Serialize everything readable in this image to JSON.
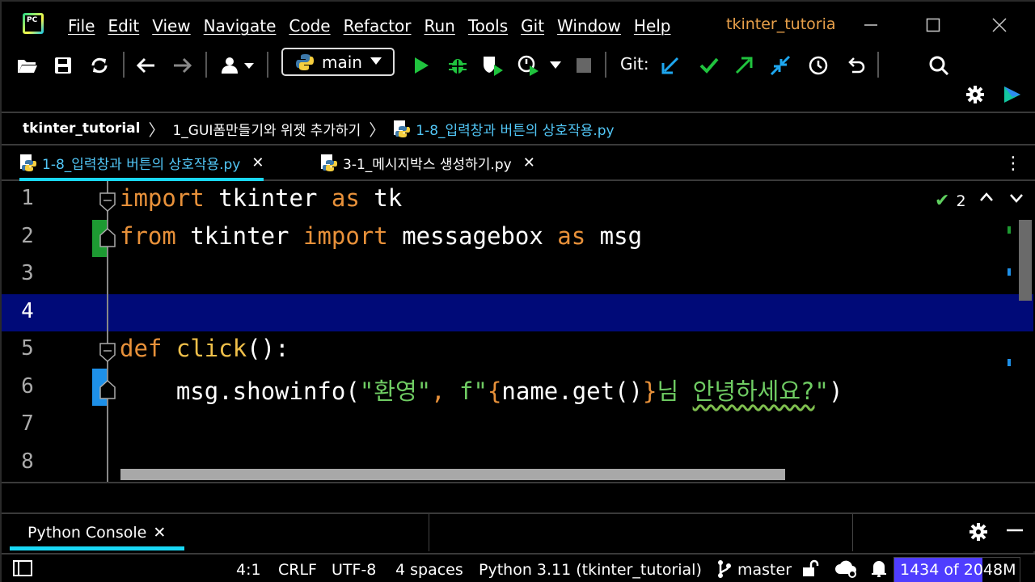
{
  "menubar": {
    "items": [
      "File",
      "Edit",
      "View",
      "Navigate",
      "Code",
      "Refactor",
      "Run",
      "Tools",
      "Git",
      "Window",
      "Help"
    ],
    "project_title": "tkinter_tutoria",
    "logo_text": "PC"
  },
  "toolbar": {
    "branch": "main",
    "git_label": "Git:",
    "icons": [
      "open-folder-icon",
      "save-icon",
      "sync-icon",
      "back-icon",
      "forward-icon",
      "user-icon",
      "run-icon",
      "debug-icon",
      "coverage-icon",
      "profile-icon",
      "stop-icon",
      "git-update-icon",
      "git-commit-icon",
      "git-push-icon",
      "git-merge-icon",
      "history-icon",
      "rollback-icon",
      "search-icon",
      "settings-icon",
      "jetbrains-ai-icon"
    ]
  },
  "breadcrumb": {
    "project": "tkinter_tutorial",
    "folder": "1_GUI폼만들기와 위젯 추가하기",
    "file": "1-8_입력창과 버튼의 상호작용.py"
  },
  "tabs": [
    {
      "label": "1-8_입력창과 버튼의 상호작용.py",
      "active": true
    },
    {
      "label": "3-1_메시지박스 생성하기.py",
      "active": false
    }
  ],
  "editor": {
    "inspection_count": "2",
    "current_line": 4,
    "lines": [
      {
        "n": "1",
        "parts": [
          [
            "kw",
            "import"
          ],
          [
            "txt",
            " tkinter "
          ],
          [
            "kw",
            "as"
          ],
          [
            "txt",
            " tk"
          ]
        ]
      },
      {
        "n": "2",
        "parts": [
          [
            "kw",
            "from"
          ],
          [
            "txt",
            " tkinter "
          ],
          [
            "kw",
            "import"
          ],
          [
            "txt",
            " messagebox "
          ],
          [
            "kw",
            "as"
          ],
          [
            "txt",
            " msg"
          ]
        ]
      },
      {
        "n": "3",
        "parts": []
      },
      {
        "n": "4",
        "parts": []
      },
      {
        "n": "5",
        "parts": [
          [
            "kw",
            "def"
          ],
          [
            "txt",
            " "
          ],
          [
            "fn",
            "click"
          ],
          [
            "txt",
            "():"
          ]
        ]
      },
      {
        "n": "6",
        "parts": [
          [
            "txt",
            "    msg.showinfo("
          ],
          [
            "str",
            "\"환영\""
          ],
          [
            "kw",
            ","
          ],
          [
            "txt",
            " "
          ],
          [
            "str",
            "f\""
          ],
          [
            "brace",
            "{"
          ],
          [
            "txt",
            "name.get()"
          ],
          [
            "brace",
            "}"
          ],
          [
            "str",
            "님 "
          ],
          [
            "squig",
            "안녕하세요?"
          ],
          [
            "str",
            "\""
          ],
          [
            "txt",
            ")"
          ]
        ]
      },
      {
        "n": "7",
        "parts": []
      },
      {
        "n": "8",
        "parts": []
      }
    ]
  },
  "tool_window": {
    "tab_label": "Python Console"
  },
  "statusbar": {
    "position": "4:1",
    "line_sep": "CRLF",
    "encoding": "UTF-8",
    "indent": "4 spaces",
    "interpreter": "Python 3.11 (tkinter_tutorial)",
    "branch": "master",
    "memory": "1434 of 2048M",
    "memory_used_fraction": 0.7
  },
  "colors": {
    "keyword": "#e8913a",
    "function": "#f0c04a",
    "string": "#6fcc63",
    "current_line": "#000a78",
    "accent": "#19d8f6",
    "memory_fill": "#4f3dff"
  }
}
